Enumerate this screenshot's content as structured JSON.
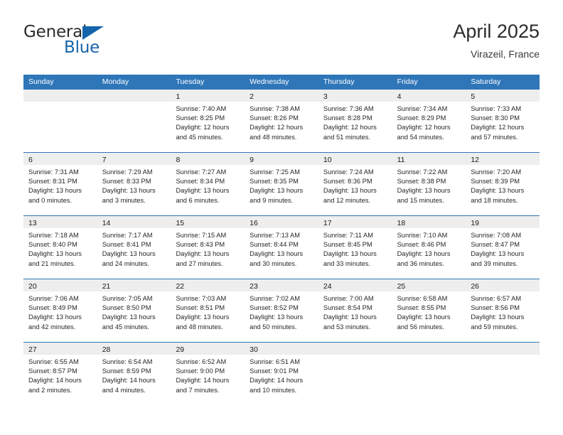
{
  "brand": {
    "name_part1": "General",
    "name_part2": "Blue"
  },
  "header": {
    "title": "April 2025",
    "location": "Virazeil, France"
  },
  "colors": {
    "header_blue": "#2e76b8",
    "brand_blue": "#1464aa",
    "day_band_gray": "#eeeeee",
    "text_dark": "#1a1a1a"
  },
  "weekdays": [
    "Sunday",
    "Monday",
    "Tuesday",
    "Wednesday",
    "Thursday",
    "Friday",
    "Saturday"
  ],
  "weeks": [
    [
      {
        "day": "",
        "sunrise": "",
        "sunset": "",
        "daylight1": "",
        "daylight2": ""
      },
      {
        "day": "",
        "sunrise": "",
        "sunset": "",
        "daylight1": "",
        "daylight2": ""
      },
      {
        "day": "1",
        "sunrise": "Sunrise: 7:40 AM",
        "sunset": "Sunset: 8:25 PM",
        "daylight1": "Daylight: 12 hours",
        "daylight2": "and 45 minutes."
      },
      {
        "day": "2",
        "sunrise": "Sunrise: 7:38 AM",
        "sunset": "Sunset: 8:26 PM",
        "daylight1": "Daylight: 12 hours",
        "daylight2": "and 48 minutes."
      },
      {
        "day": "3",
        "sunrise": "Sunrise: 7:36 AM",
        "sunset": "Sunset: 8:28 PM",
        "daylight1": "Daylight: 12 hours",
        "daylight2": "and 51 minutes."
      },
      {
        "day": "4",
        "sunrise": "Sunrise: 7:34 AM",
        "sunset": "Sunset: 8:29 PM",
        "daylight1": "Daylight: 12 hours",
        "daylight2": "and 54 minutes."
      },
      {
        "day": "5",
        "sunrise": "Sunrise: 7:33 AM",
        "sunset": "Sunset: 8:30 PM",
        "daylight1": "Daylight: 12 hours",
        "daylight2": "and 57 minutes."
      }
    ],
    [
      {
        "day": "6",
        "sunrise": "Sunrise: 7:31 AM",
        "sunset": "Sunset: 8:31 PM",
        "daylight1": "Daylight: 13 hours",
        "daylight2": "and 0 minutes."
      },
      {
        "day": "7",
        "sunrise": "Sunrise: 7:29 AM",
        "sunset": "Sunset: 8:33 PM",
        "daylight1": "Daylight: 13 hours",
        "daylight2": "and 3 minutes."
      },
      {
        "day": "8",
        "sunrise": "Sunrise: 7:27 AM",
        "sunset": "Sunset: 8:34 PM",
        "daylight1": "Daylight: 13 hours",
        "daylight2": "and 6 minutes."
      },
      {
        "day": "9",
        "sunrise": "Sunrise: 7:25 AM",
        "sunset": "Sunset: 8:35 PM",
        "daylight1": "Daylight: 13 hours",
        "daylight2": "and 9 minutes."
      },
      {
        "day": "10",
        "sunrise": "Sunrise: 7:24 AM",
        "sunset": "Sunset: 8:36 PM",
        "daylight1": "Daylight: 13 hours",
        "daylight2": "and 12 minutes."
      },
      {
        "day": "11",
        "sunrise": "Sunrise: 7:22 AM",
        "sunset": "Sunset: 8:38 PM",
        "daylight1": "Daylight: 13 hours",
        "daylight2": "and 15 minutes."
      },
      {
        "day": "12",
        "sunrise": "Sunrise: 7:20 AM",
        "sunset": "Sunset: 8:39 PM",
        "daylight1": "Daylight: 13 hours",
        "daylight2": "and 18 minutes."
      }
    ],
    [
      {
        "day": "13",
        "sunrise": "Sunrise: 7:18 AM",
        "sunset": "Sunset: 8:40 PM",
        "daylight1": "Daylight: 13 hours",
        "daylight2": "and 21 minutes."
      },
      {
        "day": "14",
        "sunrise": "Sunrise: 7:17 AM",
        "sunset": "Sunset: 8:41 PM",
        "daylight1": "Daylight: 13 hours",
        "daylight2": "and 24 minutes."
      },
      {
        "day": "15",
        "sunrise": "Sunrise: 7:15 AM",
        "sunset": "Sunset: 8:43 PM",
        "daylight1": "Daylight: 13 hours",
        "daylight2": "and 27 minutes."
      },
      {
        "day": "16",
        "sunrise": "Sunrise: 7:13 AM",
        "sunset": "Sunset: 8:44 PM",
        "daylight1": "Daylight: 13 hours",
        "daylight2": "and 30 minutes."
      },
      {
        "day": "17",
        "sunrise": "Sunrise: 7:11 AM",
        "sunset": "Sunset: 8:45 PM",
        "daylight1": "Daylight: 13 hours",
        "daylight2": "and 33 minutes."
      },
      {
        "day": "18",
        "sunrise": "Sunrise: 7:10 AM",
        "sunset": "Sunset: 8:46 PM",
        "daylight1": "Daylight: 13 hours",
        "daylight2": "and 36 minutes."
      },
      {
        "day": "19",
        "sunrise": "Sunrise: 7:08 AM",
        "sunset": "Sunset: 8:47 PM",
        "daylight1": "Daylight: 13 hours",
        "daylight2": "and 39 minutes."
      }
    ],
    [
      {
        "day": "20",
        "sunrise": "Sunrise: 7:06 AM",
        "sunset": "Sunset: 8:49 PM",
        "daylight1": "Daylight: 13 hours",
        "daylight2": "and 42 minutes."
      },
      {
        "day": "21",
        "sunrise": "Sunrise: 7:05 AM",
        "sunset": "Sunset: 8:50 PM",
        "daylight1": "Daylight: 13 hours",
        "daylight2": "and 45 minutes."
      },
      {
        "day": "22",
        "sunrise": "Sunrise: 7:03 AM",
        "sunset": "Sunset: 8:51 PM",
        "daylight1": "Daylight: 13 hours",
        "daylight2": "and 48 minutes."
      },
      {
        "day": "23",
        "sunrise": "Sunrise: 7:02 AM",
        "sunset": "Sunset: 8:52 PM",
        "daylight1": "Daylight: 13 hours",
        "daylight2": "and 50 minutes."
      },
      {
        "day": "24",
        "sunrise": "Sunrise: 7:00 AM",
        "sunset": "Sunset: 8:54 PM",
        "daylight1": "Daylight: 13 hours",
        "daylight2": "and 53 minutes."
      },
      {
        "day": "25",
        "sunrise": "Sunrise: 6:58 AM",
        "sunset": "Sunset: 8:55 PM",
        "daylight1": "Daylight: 13 hours",
        "daylight2": "and 56 minutes."
      },
      {
        "day": "26",
        "sunrise": "Sunrise: 6:57 AM",
        "sunset": "Sunset: 8:56 PM",
        "daylight1": "Daylight: 13 hours",
        "daylight2": "and 59 minutes."
      }
    ],
    [
      {
        "day": "27",
        "sunrise": "Sunrise: 6:55 AM",
        "sunset": "Sunset: 8:57 PM",
        "daylight1": "Daylight: 14 hours",
        "daylight2": "and 2 minutes."
      },
      {
        "day": "28",
        "sunrise": "Sunrise: 6:54 AM",
        "sunset": "Sunset: 8:59 PM",
        "daylight1": "Daylight: 14 hours",
        "daylight2": "and 4 minutes."
      },
      {
        "day": "29",
        "sunrise": "Sunrise: 6:52 AM",
        "sunset": "Sunset: 9:00 PM",
        "daylight1": "Daylight: 14 hours",
        "daylight2": "and 7 minutes."
      },
      {
        "day": "30",
        "sunrise": "Sunrise: 6:51 AM",
        "sunset": "Sunset: 9:01 PM",
        "daylight1": "Daylight: 14 hours",
        "daylight2": "and 10 minutes."
      },
      {
        "day": "",
        "sunrise": "",
        "sunset": "",
        "daylight1": "",
        "daylight2": ""
      },
      {
        "day": "",
        "sunrise": "",
        "sunset": "",
        "daylight1": "",
        "daylight2": ""
      },
      {
        "day": "",
        "sunrise": "",
        "sunset": "",
        "daylight1": "",
        "daylight2": ""
      }
    ]
  ]
}
